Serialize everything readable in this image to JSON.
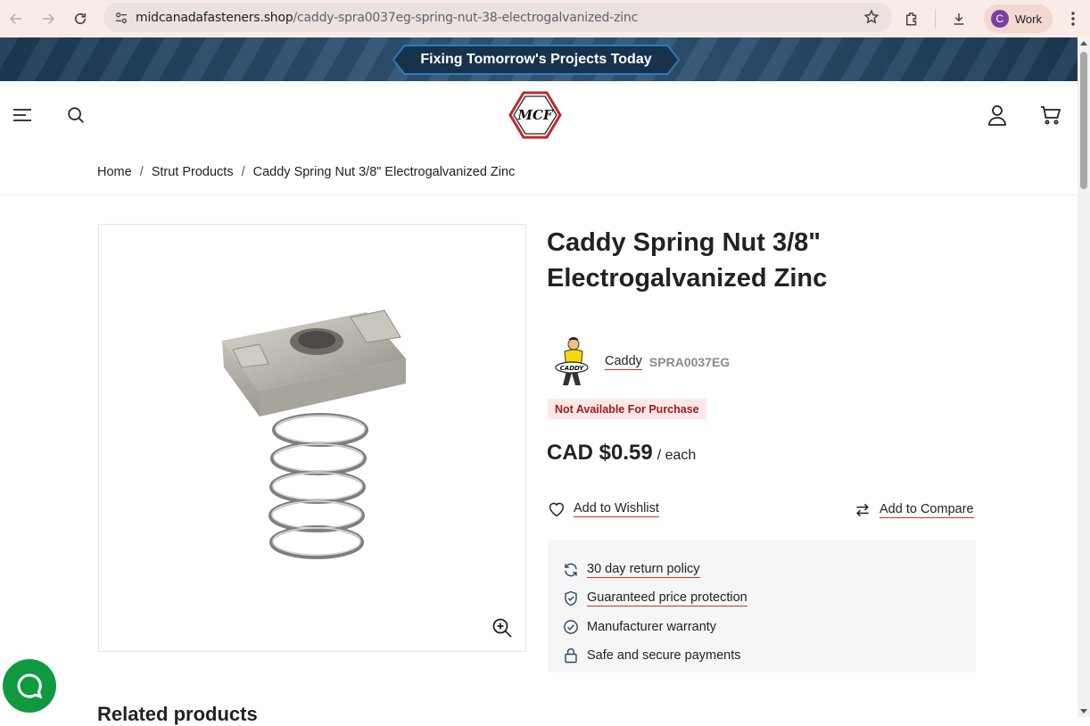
{
  "browser": {
    "url_host": "midcanadafasteners.shop",
    "url_path": "/caddy-spra0037eg-spring-nut-38-electrogalvanized-zinc",
    "profile_initial": "C",
    "profile_label": "Work"
  },
  "promo": {
    "text": "Fixing Tomorrow's Projects Today"
  },
  "header": {
    "logo_text": "MCF"
  },
  "breadcrumb": [
    "Home",
    "Strut Products",
    "Caddy Spring Nut 3/8\" Electrogalvanized Zinc"
  ],
  "product": {
    "title": "Caddy Spring Nut 3/8\" Electrogalvanized Zinc",
    "brand": "Caddy",
    "brand_logo_text": "CADDY",
    "sku": "SPRA0037EG",
    "availability": "Not Available For Purchase",
    "price": "CAD $0.59",
    "price_unit": "/ each",
    "wishlist_label": "Add to Wishlist",
    "compare_label": "Add to Compare"
  },
  "perks": [
    {
      "icon": "refresh-icon",
      "label": "30 day return policy"
    },
    {
      "icon": "shield-check-icon",
      "label": "Guaranteed price protection"
    },
    {
      "icon": "circle-check-icon",
      "label": "Manufacturer warranty"
    },
    {
      "icon": "lock-icon",
      "label": "Safe and secure payments"
    }
  ],
  "related": {
    "heading": "Related products"
  },
  "colors": {
    "accent_red": "#c0392b",
    "availability_bg": "#fde8e8",
    "chat_green": "#0f9a3f"
  }
}
